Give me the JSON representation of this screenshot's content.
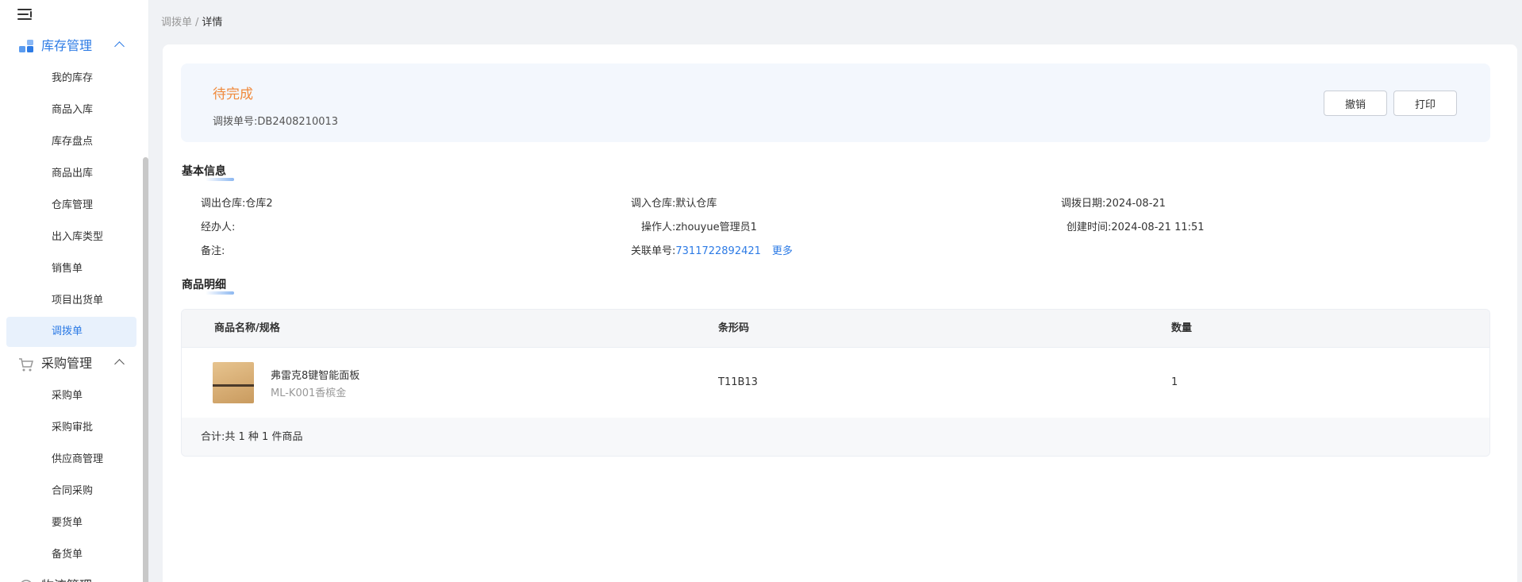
{
  "breadcrumb": {
    "parent": "调拨单",
    "separator": "/",
    "current": "详情"
  },
  "sidebar": {
    "groups": [
      {
        "label": "库存管理",
        "icon": "inventory-icon"
      },
      {
        "label": "采购管理",
        "icon": "cart-icon"
      },
      {
        "label": "物流管理",
        "icon": "logistics-icon"
      }
    ],
    "inventory_items": [
      {
        "label": "我的库存"
      },
      {
        "label": "商品入库"
      },
      {
        "label": "库存盘点"
      },
      {
        "label": "商品出库"
      },
      {
        "label": "仓库管理"
      },
      {
        "label": "出入库类型"
      },
      {
        "label": "销售单"
      },
      {
        "label": "项目出货单"
      },
      {
        "label": "调拨单"
      }
    ],
    "purchase_items": [
      {
        "label": "采购单"
      },
      {
        "label": "采购审批"
      },
      {
        "label": "供应商管理"
      },
      {
        "label": "合同采购"
      },
      {
        "label": "要货单"
      },
      {
        "label": "备货单"
      }
    ],
    "active_item": "调拨单",
    "accent_color": "#2d7be5"
  },
  "status": {
    "title": "待完成",
    "order_no_label": "调拨单号:",
    "order_no": "DB2408210013",
    "title_color": "#f08a3c"
  },
  "actions": {
    "cancel": "撤销",
    "print": "打印"
  },
  "basic_info": {
    "title": "基本信息",
    "out_warehouse_label": "调出仓库:",
    "out_warehouse": "仓库2",
    "in_warehouse_label": "调入仓库:",
    "in_warehouse": "默认仓库",
    "date_label": "调拨日期:",
    "date": "2024-08-21",
    "handler_label": "经办人:",
    "handler": "",
    "operator_label": "操作人:",
    "operator": "zhouyue管理员1",
    "created_label": "创建时间:",
    "created": "2024-08-21 11:51",
    "remark_label": "备注:",
    "remark": "",
    "related_label": "关联单号:",
    "related": "7311722892421",
    "more": "更多"
  },
  "goods": {
    "title": "商品明细",
    "columns": {
      "name": "商品名称/规格",
      "barcode": "条形码",
      "qty": "数量"
    },
    "rows": [
      {
        "name": "弗雷克8键智能面板",
        "spec": "ML-K001香槟金",
        "barcode": "T11B13",
        "qty": "1"
      }
    ],
    "total": "合计:共 1 种 1 件商品"
  }
}
